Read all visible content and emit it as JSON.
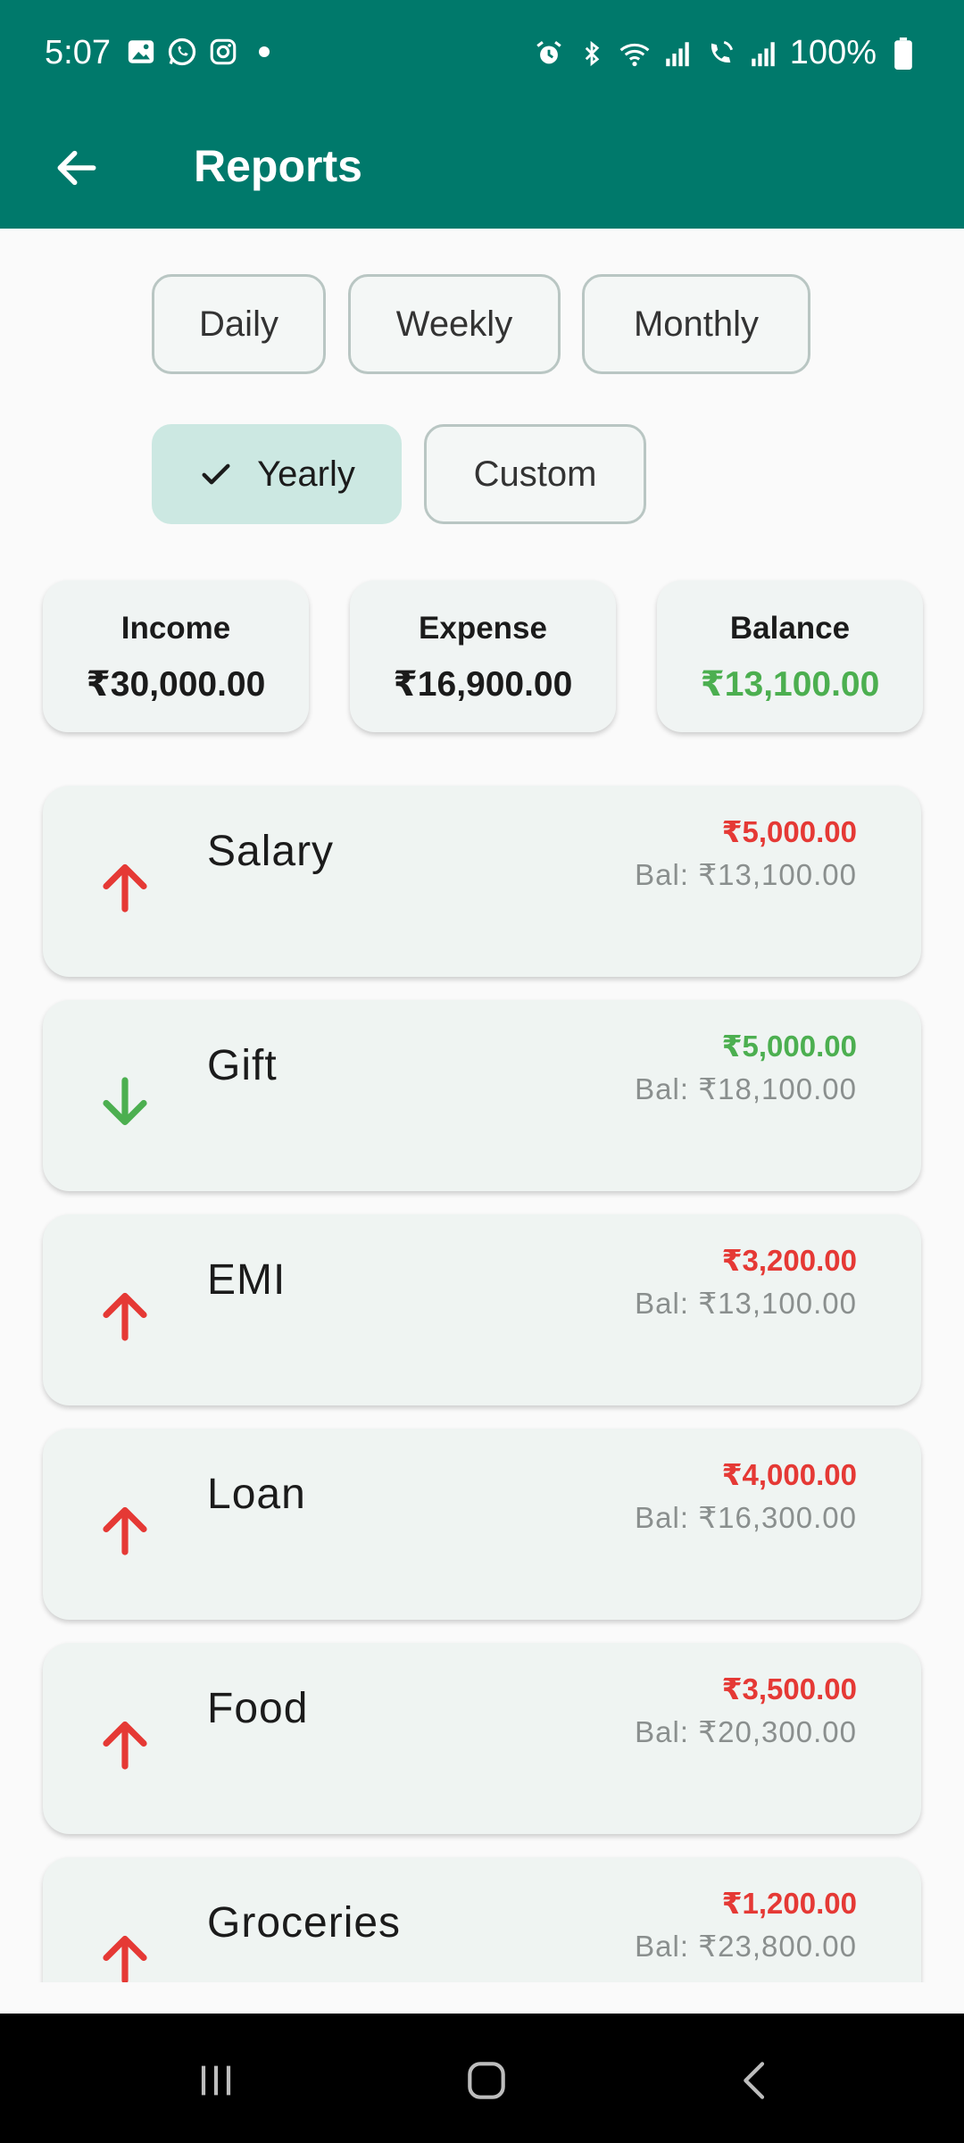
{
  "status_bar": {
    "time": "5:07",
    "battery": "100%",
    "left_icons": [
      "gallery-icon",
      "whatsapp-icon",
      "instagram-icon",
      "dot-icon"
    ],
    "right_icons": [
      "alarm-icon",
      "bluetooth-icon",
      "wifi-icon",
      "signal-icon",
      "call-signal-icon",
      "signal-2-icon",
      "battery-icon"
    ]
  },
  "app_bar": {
    "title": "Reports"
  },
  "filters": {
    "daily": "Daily",
    "weekly": "Weekly",
    "monthly": "Monthly",
    "yearly": "Yearly",
    "custom": "Custom",
    "selected": "Yearly"
  },
  "summary": {
    "income_label": "Income",
    "income_value": "₹30,000.00",
    "expense_label": "Expense",
    "expense_value": "₹16,900.00",
    "balance_label": "Balance",
    "balance_value": "₹13,100.00"
  },
  "transactions": [
    {
      "name": "Salary",
      "amount": "₹5,000.00",
      "balance": "Bal: ₹13,100.00",
      "direction": "up"
    },
    {
      "name": "Gift",
      "amount": "₹5,000.00",
      "balance": "Bal: ₹18,100.00",
      "direction": "down"
    },
    {
      "name": "EMI",
      "amount": "₹3,200.00",
      "balance": "Bal: ₹13,100.00",
      "direction": "up"
    },
    {
      "name": "Loan",
      "amount": "₹4,000.00",
      "balance": "Bal: ₹16,300.00",
      "direction": "up"
    },
    {
      "name": "Food",
      "amount": "₹3,500.00",
      "balance": "Bal: ₹20,300.00",
      "direction": "up"
    },
    {
      "name": "Groceries",
      "amount": "₹1,200.00",
      "balance": "Bal: ₹23,800.00",
      "direction": "up"
    }
  ],
  "colors": {
    "primary": "#00796b",
    "selected_chip": "#cce8e2",
    "expense": "#e53935",
    "income": "#4caf50"
  }
}
